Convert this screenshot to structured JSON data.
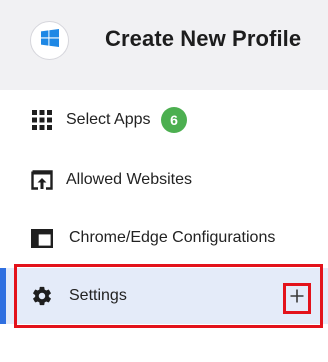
{
  "header": {
    "os_icon": "windows-logo-icon",
    "title": "Create New Profile"
  },
  "nav": {
    "items": [
      {
        "key": "select-apps",
        "icon": "grid-icon",
        "label": "Select Apps",
        "badge": "6"
      },
      {
        "key": "allowed-websites",
        "icon": "upload-window-icon",
        "label": "Allowed Websites"
      },
      {
        "key": "chrome-edge",
        "icon": "browser-window-icon",
        "label": "Chrome/Edge Configurations"
      },
      {
        "key": "settings",
        "icon": "gear-icon",
        "label": "Settings",
        "expand_icon": "plus-icon",
        "expand_symbol": "+"
      }
    ],
    "active": "settings"
  },
  "colors": {
    "header_bg": "#f1f1f3",
    "active_bg": "#e4ebf9",
    "active_indicator": "#2f6fe0",
    "badge_green": "#4caf50",
    "annotation_red": "#e3121b",
    "windows_blue": "#1e88e5"
  }
}
